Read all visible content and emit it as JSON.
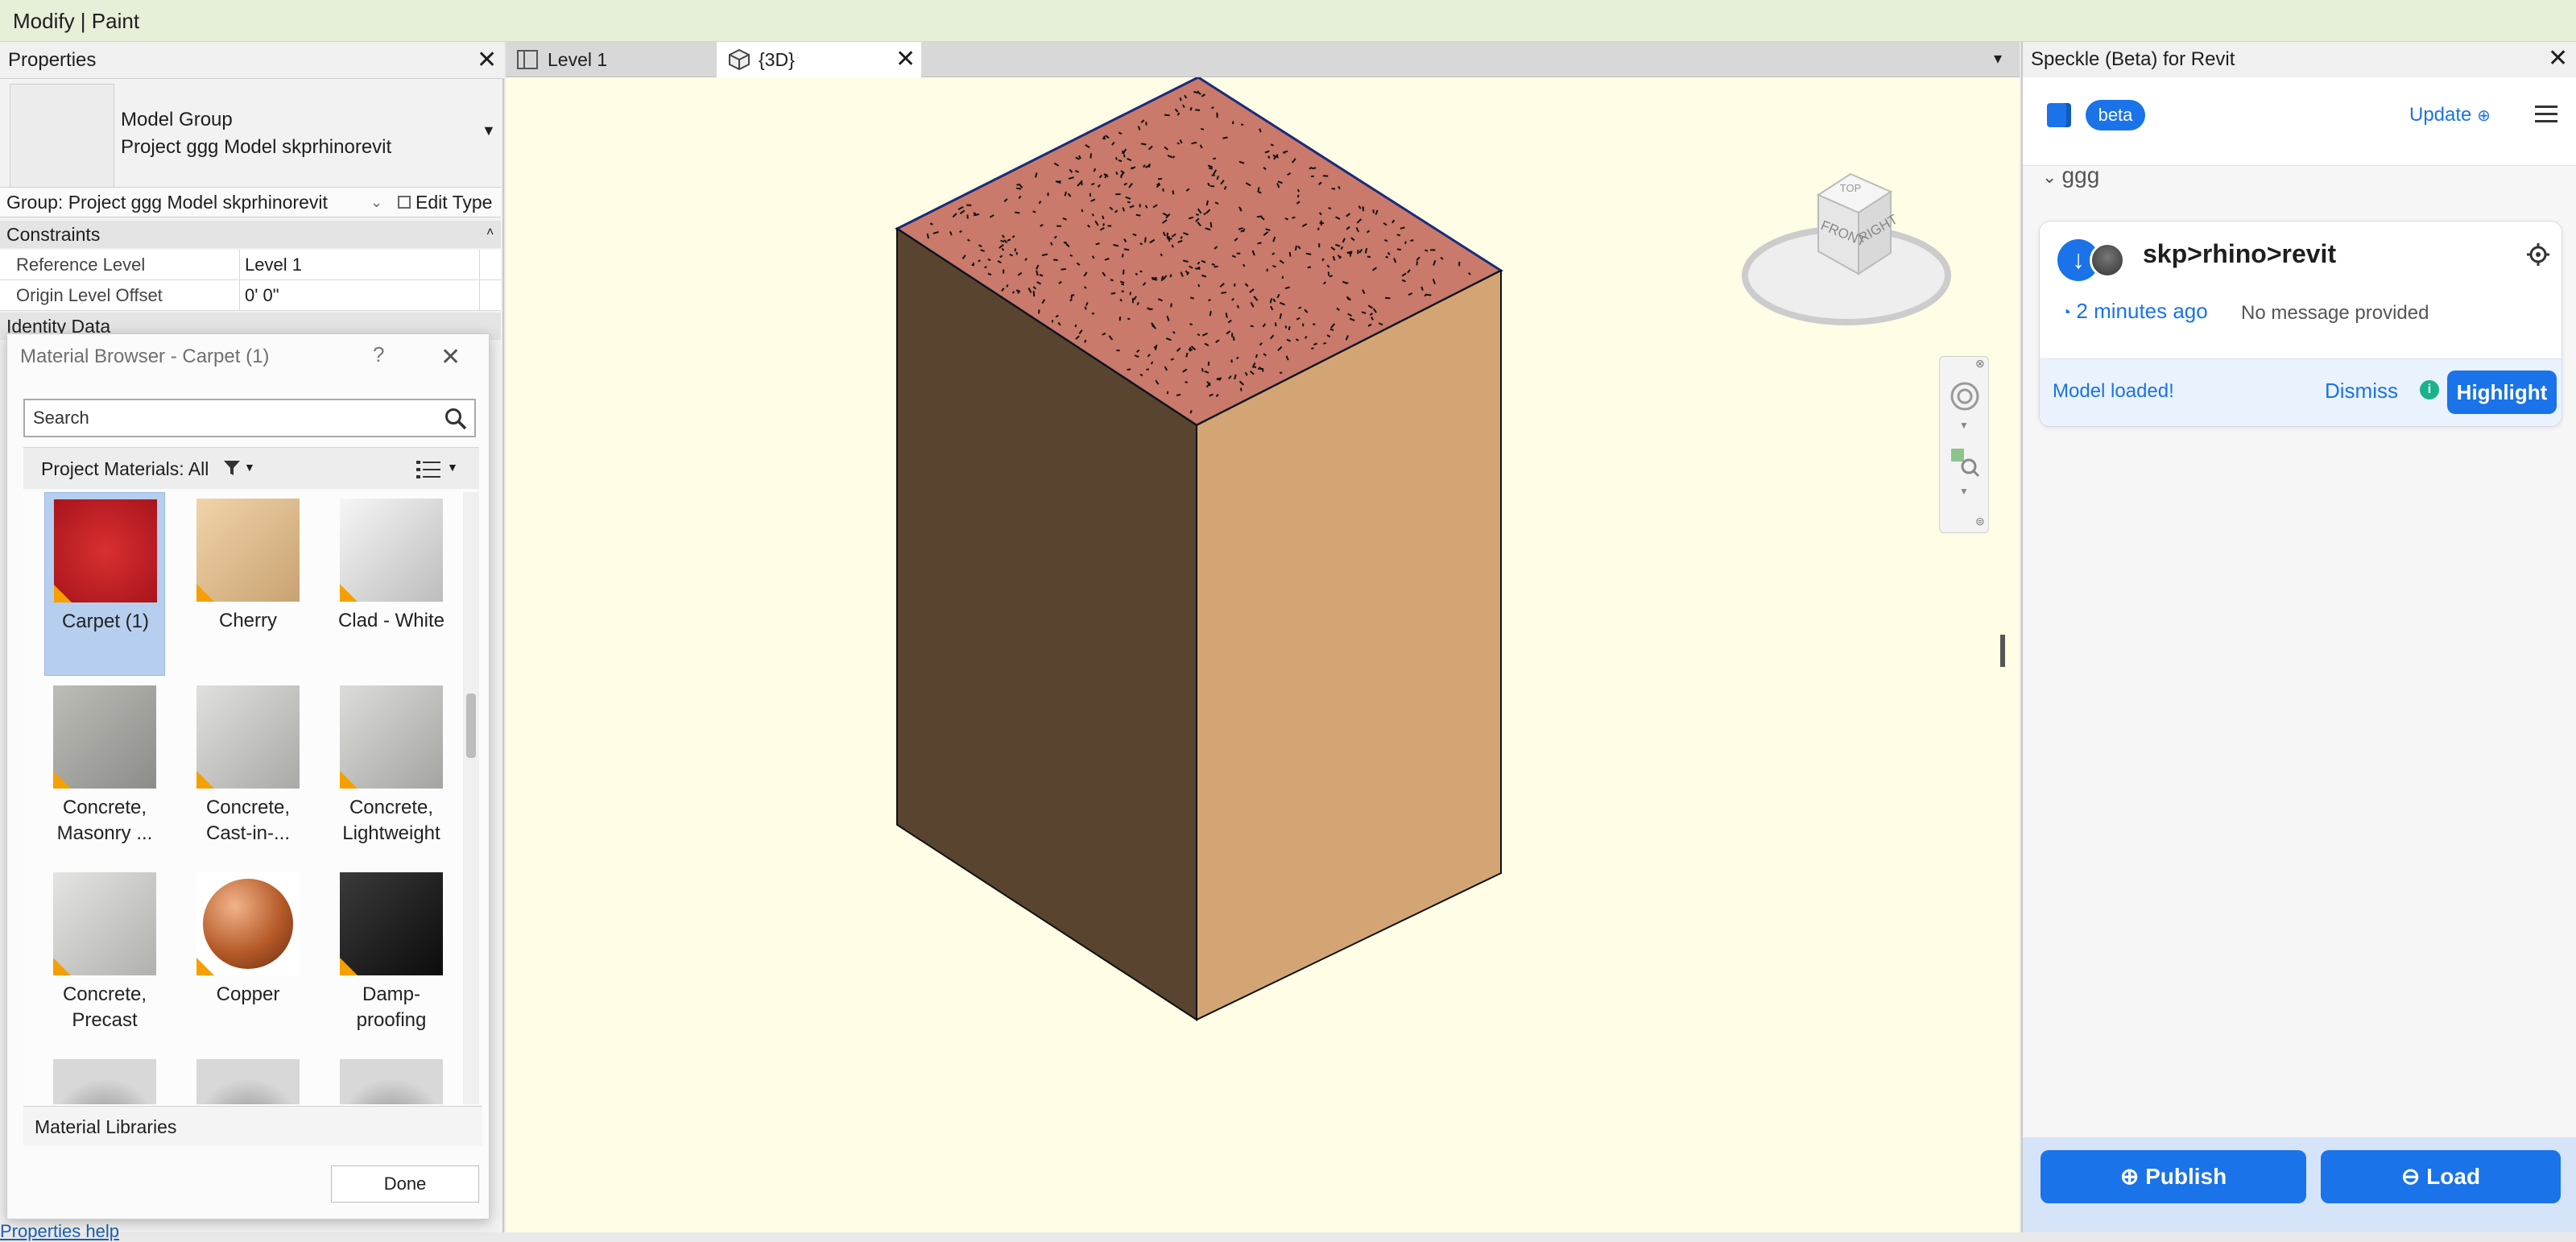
{
  "context_bar": {
    "title": "Modify | Paint"
  },
  "properties": {
    "title": "Properties",
    "type_line1": "Model Group",
    "type_line2": "Project ggg Model skprhinorevit",
    "selector": "Group: Project ggg Model skprhinorevit",
    "edit_type": "Edit Type",
    "sections": {
      "constraints": "Constraints",
      "identity": "Identity Data"
    },
    "rows": [
      {
        "key": "Reference Level",
        "value": "Level 1"
      },
      {
        "key": "Origin Level Offset",
        "value": "0'  0\""
      }
    ],
    "help_link": "Properties help"
  },
  "material_browser": {
    "title": "Material Browser - Carpet (1)",
    "help": "?",
    "search_placeholder": "Search",
    "library_header": "Project Materials: All",
    "materials": [
      {
        "line1": "Carpet (1)",
        "line2": "",
        "selected": true,
        "color": "#b81e24"
      },
      {
        "line1": "Cherry",
        "line2": "",
        "color": "#e2c08e"
      },
      {
        "line1": "Clad - White",
        "line2": "",
        "color": "#e2e2e2"
      },
      {
        "line1": "Concrete,",
        "line2": "Masonry ...",
        "color": "#a9a9a4"
      },
      {
        "line1": "Concrete,",
        "line2": "Cast-in-...",
        "color": "#c9c9c6"
      },
      {
        "line1": "Concrete,",
        "line2": "Lightweight",
        "color": "#c6c6c3"
      },
      {
        "line1": "Concrete,",
        "line2": "Precast",
        "color": "#cfcfcd"
      },
      {
        "line1": "Copper",
        "line2": "",
        "color": "#c46a3a"
      },
      {
        "line1": "Damp-",
        "line2": "proofing",
        "color": "#1e1e1e"
      }
    ],
    "libraries_label": "Material Libraries",
    "done_label": "Done"
  },
  "viewport": {
    "tabs": [
      {
        "label": "Level 1"
      },
      {
        "label": "{3D}"
      }
    ],
    "viewcube": {
      "top": "TOP",
      "front": "FRONT",
      "right": "RIGHT"
    },
    "colors": {
      "top": "#c97a6a",
      "left": "#594430",
      "right": "#d4a574",
      "edge": "#1a2a7a",
      "background": "#fffde5"
    }
  },
  "speckle": {
    "title": "Speckle (Beta) for Revit",
    "badge": "beta",
    "update_label": "Update",
    "project": "ggg",
    "model_name": "skp>rhino>revit",
    "time": "2 minutes ago",
    "message": "No message provided",
    "status": "Model loaded!",
    "dismiss_label": "Dismiss",
    "highlight_label": "Highlight",
    "publish_label": "Publish",
    "load_label": "Load",
    "accent": "#1a73e8"
  }
}
